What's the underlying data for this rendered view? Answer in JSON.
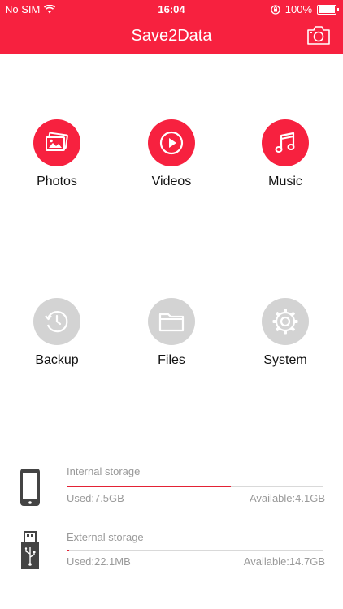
{
  "status": {
    "carrier": "No SIM",
    "time": "16:04",
    "battery": "100%"
  },
  "header": {
    "title": "Save2Data",
    "color": "#f7213f"
  },
  "tiles": [
    {
      "label": "Photos",
      "icon": "photos-icon",
      "active": true
    },
    {
      "label": "Videos",
      "icon": "play-icon",
      "active": true
    },
    {
      "label": "Music",
      "icon": "music-note-icon",
      "active": true
    },
    {
      "label": "Backup",
      "icon": "history-clock-icon",
      "active": false
    },
    {
      "label": "Files",
      "icon": "folder-icon",
      "active": false
    },
    {
      "label": "System",
      "icon": "gear-icon",
      "active": false
    }
  ],
  "storage": {
    "internal": {
      "title": "Internal storage",
      "used": "Used:7.5GB",
      "available": "Available:4.1GB",
      "fill_fraction": 0.64
    },
    "external": {
      "title": "External storage",
      "used": "Used:22.1MB",
      "available": "Available:14.7GB",
      "fill_fraction": 0.01
    }
  },
  "colors": {
    "accent": "#f7213f",
    "inactive": "#d3d3d3",
    "muted_text": "#9a9a9a"
  }
}
